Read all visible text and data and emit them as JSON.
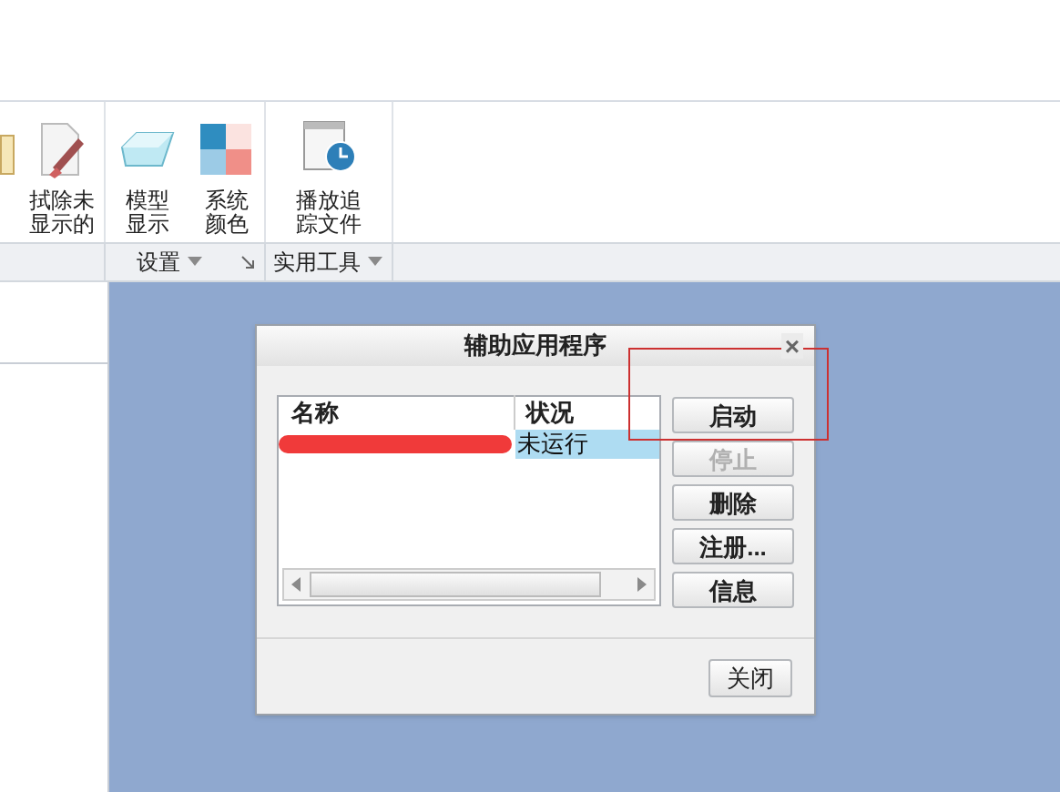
{
  "ribbon": {
    "items": [
      {
        "kind": "erase",
        "lines": [
          "拭除未",
          "显示的"
        ]
      },
      {
        "kind": "model",
        "lines": [
          "模型",
          "显示"
        ]
      },
      {
        "kind": "color",
        "lines": [
          "系统",
          "颜色"
        ]
      },
      {
        "kind": "trace",
        "lines": [
          "播放追",
          "踪文件"
        ]
      }
    ],
    "groups": [
      {
        "label": "设置",
        "launcher": true
      },
      {
        "label": "实用工具",
        "launcher": false
      }
    ]
  },
  "dialog": {
    "title": "辅助应用程序",
    "close_glyph": "×",
    "columns": [
      "名称",
      "状况"
    ],
    "rows": [
      {
        "status": "未运行",
        "selected": true,
        "redacted": true
      }
    ],
    "buttons": [
      {
        "label": "启动",
        "disabled": false,
        "highlighted": true
      },
      {
        "label": "停止",
        "disabled": true,
        "highlighted": false
      },
      {
        "label": "删除",
        "disabled": false,
        "highlighted": false
      },
      {
        "label": "注册...",
        "disabled": false,
        "highlighted": false
      },
      {
        "label": "信息",
        "disabled": false,
        "highlighted": false
      }
    ],
    "footer_button": "关闭"
  }
}
